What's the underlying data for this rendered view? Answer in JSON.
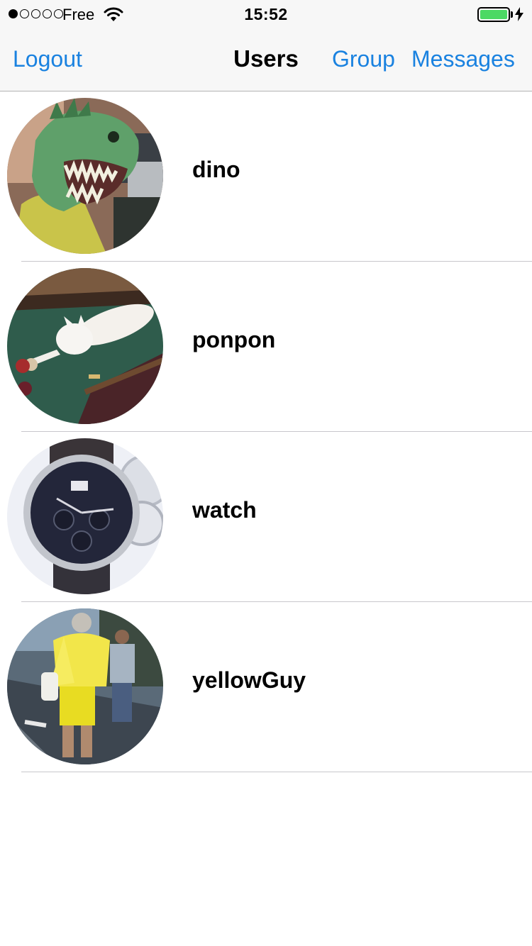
{
  "status_bar": {
    "carrier": "Free",
    "time": "15:52",
    "signal_bars": 1,
    "signal_total": 5,
    "battery_level": 1.0,
    "icons": [
      "wifi-icon",
      "battery-icon",
      "charging-bolt-icon"
    ]
  },
  "nav": {
    "left_button": "Logout",
    "title": "Users",
    "right_buttons": [
      "Group",
      "Messages"
    ],
    "accent_color": "#1a82e0"
  },
  "users": [
    {
      "name": "dino",
      "avatar": "dinosaur-mask-photo"
    },
    {
      "name": "ponpon",
      "avatar": "white-kitten-on-pool-table-photo"
    },
    {
      "name": "watch",
      "avatar": "wristwatch-photo"
    },
    {
      "name": "yellowGuy",
      "avatar": "man-in-yellow-street-photo"
    }
  ]
}
